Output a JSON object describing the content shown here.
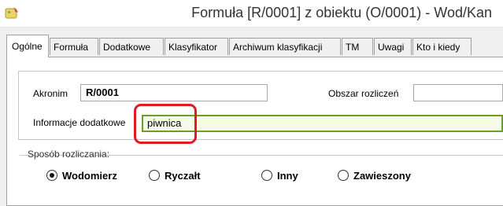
{
  "window": {
    "title": "Formuła [R/0001] z obiektu (O/0001) - Wod/Kan"
  },
  "tabs": [
    {
      "label": "Ogólne",
      "active": true
    },
    {
      "label": "Formuła"
    },
    {
      "label": "Dodatkowe"
    },
    {
      "label": "Klasyfikator"
    },
    {
      "label": "Archiwum klasyfikacji"
    },
    {
      "label": "TM"
    },
    {
      "label": "Uwagi"
    },
    {
      "label": "Kto i kiedy"
    }
  ],
  "form": {
    "akronim_label": "Akronim",
    "akronim_value": "R/0001",
    "obszar_label": "Obszar rozliczeń",
    "obszar_value": "",
    "info_label": "Informacje dodatkowe",
    "info_value": "piwnica"
  },
  "billing": {
    "title": "Sposób rozliczania:",
    "options": [
      {
        "label": "Wodomierz",
        "selected": true
      },
      {
        "label": "Ryczałt",
        "selected": false
      },
      {
        "label": "Inny",
        "selected": false
      },
      {
        "label": "Zawieszony",
        "selected": false
      }
    ]
  },
  "colors": {
    "focus_border": "#6a9e2a",
    "highlight": "#e11b22"
  }
}
